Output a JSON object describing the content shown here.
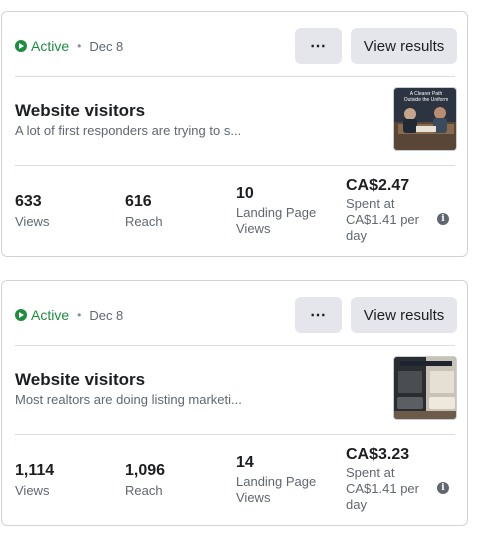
{
  "cards": [
    {
      "status": "Active",
      "date": "Dec 8",
      "more_label": "⋯",
      "view_results_label": "View results",
      "title": "Website visitors",
      "subtitle": "A lot of first responders are trying to s...",
      "thumbnail_caption": "A Clearer Path Outside the Uniform",
      "metrics": [
        {
          "value": "633",
          "label": "Views"
        },
        {
          "value": "616",
          "label": "Reach"
        },
        {
          "value": "10",
          "label": "Landing Page Views"
        },
        {
          "value": "CA$2.47",
          "label": "Spent at CA$1.41 per day"
        }
      ],
      "info_icon": "i"
    },
    {
      "status": "Active",
      "date": "Dec 8",
      "more_label": "⋯",
      "view_results_label": "View results",
      "title": "Website visitors",
      "subtitle": "Most realtors are doing listing marketi...",
      "metrics": [
        {
          "value": "1,114",
          "label": "Views"
        },
        {
          "value": "1,096",
          "label": "Reach"
        },
        {
          "value": "14",
          "label": "Landing Page Views"
        },
        {
          "value": "CA$3.23",
          "label": "Spent at CA$1.41 per day"
        }
      ],
      "info_icon": "i"
    }
  ],
  "colors": {
    "active_green": "#1e8e3e",
    "button_bg": "#e4e6eb",
    "divider": "#dadde1",
    "muted_text": "#606770"
  }
}
